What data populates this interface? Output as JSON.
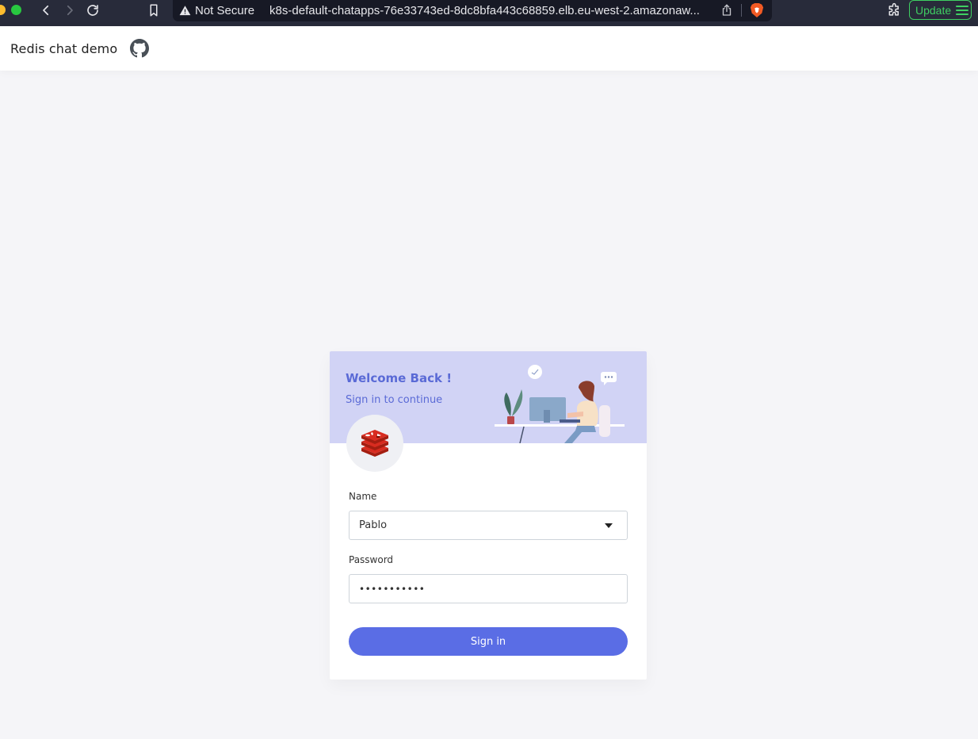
{
  "browser": {
    "security_label": "Not Secure",
    "url": "k8s-default-chatapps-76e33743ed-8dc8bfa443c68859.elb.eu-west-2.amazonaw...",
    "update_label": "Update",
    "icons": [
      "chevron-left-icon",
      "chevron-right-icon",
      "reload-icon",
      "bookmark-icon",
      "warning-icon",
      "share-icon",
      "brave-lion-icon",
      "extensions-icon",
      "menu-icon"
    ]
  },
  "header": {
    "brand": "Redis chat demo",
    "icon": "github-icon"
  },
  "login": {
    "title": "Welcome Back !",
    "subtitle": "Sign in to continue",
    "logo_icon": "redis-logo-icon",
    "name_label": "Name",
    "name_value": "Pablo",
    "password_label": "Password",
    "password_value": "•••••••••••",
    "submit_label": "Sign in"
  },
  "colors": {
    "accent": "#5a6de5",
    "hero_bg": "#d1d3f5",
    "title": "#5a6ad6",
    "update_green": "#3fcf62",
    "browser_bg": "#282b3a"
  }
}
